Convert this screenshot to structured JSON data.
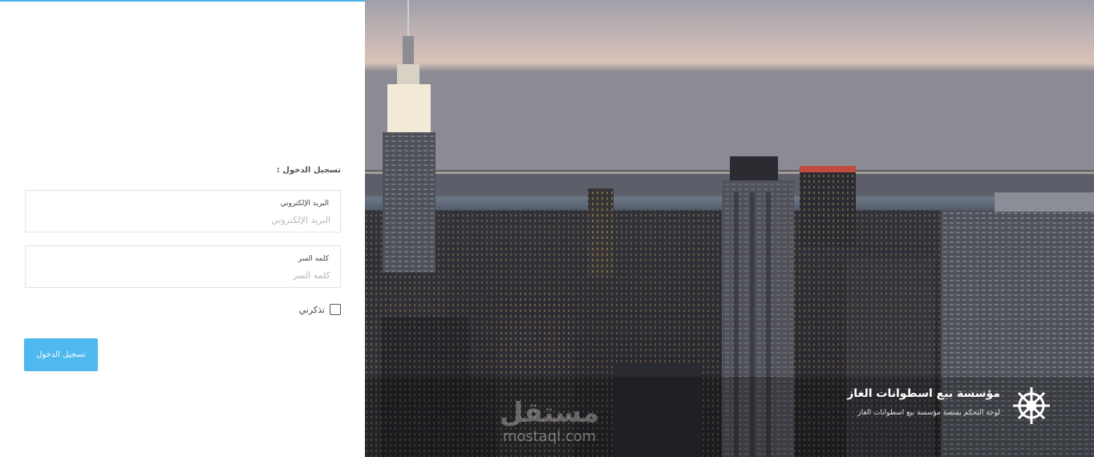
{
  "login": {
    "title": "تسجيل الدخول :",
    "email": {
      "label": "البريد الإلكتروني",
      "placeholder": "البريد الإلكتروني",
      "value": ""
    },
    "password": {
      "label": "كلمه السر",
      "placeholder": "كلمه السر",
      "value": ""
    },
    "remember_label": "تذكرني",
    "remember_checked": false,
    "submit_label": "تسجيل الدخول"
  },
  "brand": {
    "title": "مؤسسة بيع اسطوانات الغاز",
    "subtitle": "لوحة التحكم بمنصة مؤسسة بيع اسطوانات الغاز",
    "icon": "ship-wheel-icon"
  },
  "watermark": {
    "text_ar": "مستقل",
    "text_en": "mostaql.com"
  },
  "hero": {
    "image": "city-skyline-photo"
  },
  "colors": {
    "accent": "#4fb8ef",
    "top_border": "#4ab4e6",
    "text": "#444444"
  }
}
